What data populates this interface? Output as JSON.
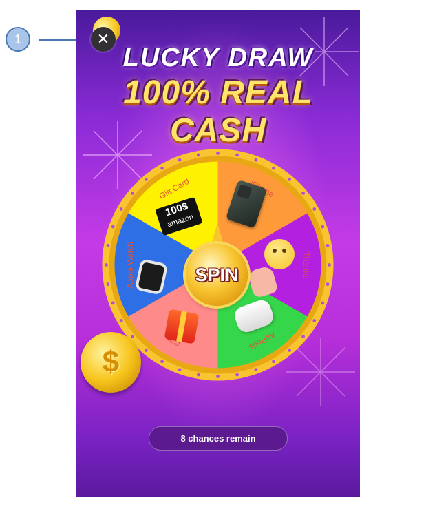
{
  "annotation": {
    "callout_number": "1"
  },
  "header": {
    "title_line1": "LUCKY DRAW",
    "title_line2": "100% REAL CASH"
  },
  "close_button": {
    "icon": "close-icon",
    "glyph": "✕"
  },
  "wheel": {
    "segments": [
      {
        "label": "Gift Card",
        "color": "#fff200",
        "icon": "amazon-gift-card-icon",
        "card_value": "100$",
        "card_brand": "amazon"
      },
      {
        "label": "iPhone",
        "color": "#ff9a3a",
        "icon": "iphone-icon"
      },
      {
        "label": "Thanks",
        "color": "#b320e0",
        "icon": "waving-emoji-icon"
      },
      {
        "label": "AirPods",
        "color": "#36d64b",
        "icon": "airpods-icon"
      },
      {
        "label": "Gift",
        "color": "#ff8a8a",
        "icon": "gift-box-icon"
      },
      {
        "label": "Apple Watch",
        "color": "#2f6fe6",
        "icon": "apple-watch-icon"
      }
    ],
    "rim_color": "#f8c531",
    "spin_label": "SPIN"
  },
  "coin": {
    "icon": "dollar-coin-icon",
    "glyph": "$"
  },
  "footer": {
    "chances_text": "8 chances remain"
  }
}
